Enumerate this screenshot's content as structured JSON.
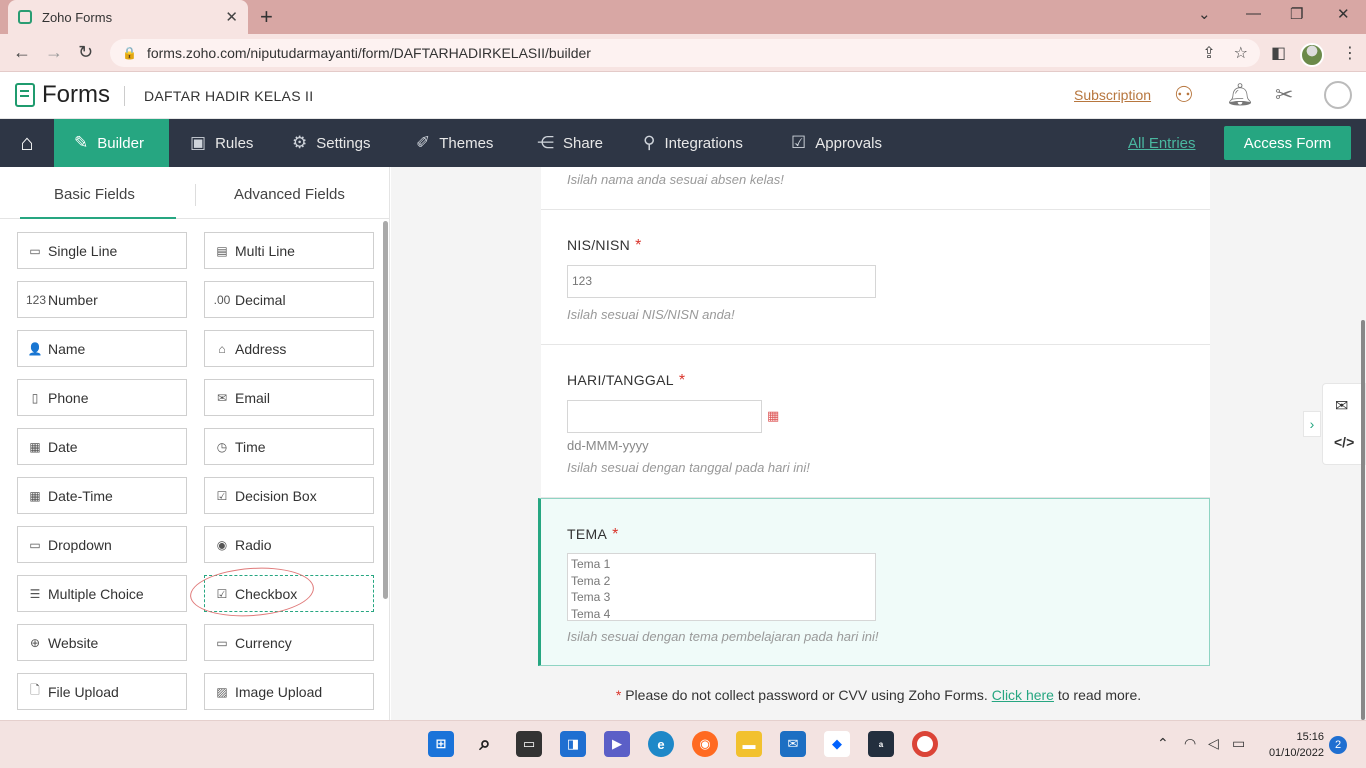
{
  "browser": {
    "tab_title": "Zoho Forms",
    "tab_close": "✕",
    "new_tab": "+",
    "url": "forms.zoho.com/niputudarmayanti/form/DAFTARHADIRKELASII/builder"
  },
  "header": {
    "logo_text": "Forms",
    "form_title": "DAFTAR HADIR KELAS II",
    "subscription": "Subscription"
  },
  "nav": {
    "items": [
      {
        "label": "Builder",
        "icon": "builder-icon"
      },
      {
        "label": "Rules",
        "icon": "rules-icon"
      },
      {
        "label": "Settings",
        "icon": "gear-icon"
      },
      {
        "label": "Themes",
        "icon": "themes-icon"
      },
      {
        "label": "Share",
        "icon": "share-icon"
      },
      {
        "label": "Integrations",
        "icon": "integrations-icon"
      },
      {
        "label": "Approvals",
        "icon": "approvals-icon"
      }
    ],
    "all_entries": "All Entries",
    "access_form": "Access Form"
  },
  "fields_panel": {
    "tabs": [
      "Basic Fields",
      "Advanced Fields"
    ],
    "fields": [
      {
        "label": "Single Line",
        "icon": "single-line-icon",
        "glyph": "▭"
      },
      {
        "label": "Multi Line",
        "icon": "multi-line-icon",
        "glyph": "▤"
      },
      {
        "label": "Number",
        "icon": "number-icon",
        "glyph": "123"
      },
      {
        "label": "Decimal",
        "icon": "decimal-icon",
        "glyph": ".00"
      },
      {
        "label": "Name",
        "icon": "person-icon",
        "glyph": "👤"
      },
      {
        "label": "Address",
        "icon": "address-icon",
        "glyph": "⌂"
      },
      {
        "label": "Phone",
        "icon": "phone-icon",
        "glyph": "▯"
      },
      {
        "label": "Email",
        "icon": "email-icon",
        "glyph": "✉"
      },
      {
        "label": "Date",
        "icon": "calendar-icon",
        "glyph": "▦"
      },
      {
        "label": "Time",
        "icon": "clock-icon",
        "glyph": "◷"
      },
      {
        "label": "Date-Time",
        "icon": "date-time-icon",
        "glyph": "▦"
      },
      {
        "label": "Decision Box",
        "icon": "checkbox-icon",
        "glyph": "☑"
      },
      {
        "label": "Dropdown",
        "icon": "dropdown-icon",
        "glyph": "▭"
      },
      {
        "label": "Radio",
        "icon": "radio-icon",
        "glyph": "◉"
      },
      {
        "label": "Multiple Choice",
        "icon": "multiple-choice-icon",
        "glyph": "☰"
      },
      {
        "label": "Checkbox",
        "icon": "checkbox-list-icon",
        "glyph": "☑"
      },
      {
        "label": "Website",
        "icon": "globe-icon",
        "glyph": "⊕"
      },
      {
        "label": "Currency",
        "icon": "currency-icon",
        "glyph": "▭"
      },
      {
        "label": "File Upload",
        "icon": "file-upload-icon",
        "glyph": "🗋"
      },
      {
        "label": "Image Upload",
        "icon": "image-upload-icon",
        "glyph": "▨"
      }
    ]
  },
  "form": {
    "name_hint": "Isilah nama anda sesuai absen kelas!",
    "nis": {
      "label": "NIS/NISN",
      "placeholder": "123",
      "hint": "Isilah sesuai NIS/NISN anda!"
    },
    "hari": {
      "label": "HARI/TANGGAL",
      "format": "dd-MMM-yyyy",
      "hint": "Isilah sesuai dengan tanggal pada hari ini!"
    },
    "tema": {
      "label": "TEMA",
      "options": [
        "Tema 1",
        "Tema 2",
        "Tema 3",
        "Tema 4"
      ],
      "hint": "Isilah sesuai dengan tema pembelajaran pada hari ini!"
    },
    "required_mark": "*"
  },
  "footnote": {
    "star": "*",
    "text": "Please do not collect password or CVV using Zoho Forms.",
    "link": "Click here",
    "suffix": "to read more."
  },
  "taskbar": {
    "time": "15:16",
    "date": "01/10/2022",
    "notifications": "2"
  },
  "colors": {
    "accent": "#26a681",
    "nav_bg": "#2e3645",
    "required": "#d9342b",
    "chrome_tab": "#d8a7a4"
  }
}
